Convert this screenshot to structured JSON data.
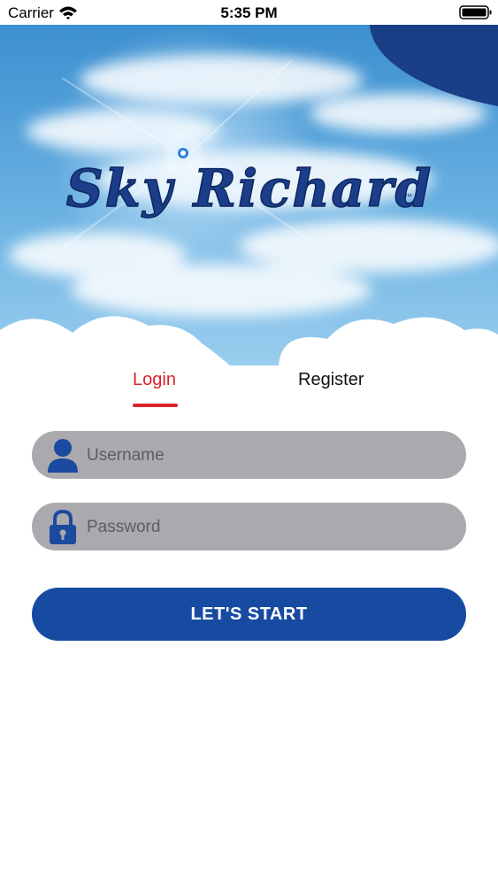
{
  "status_bar": {
    "carrier": "Carrier",
    "time": "5:35 PM",
    "wifi_icon": "wifi-icon",
    "battery_icon": "battery-icon"
  },
  "logo": {
    "text": "Sky Richard",
    "tm": "™"
  },
  "tabs": [
    {
      "label": "Login",
      "active": true
    },
    {
      "label": "Register",
      "active": false
    }
  ],
  "form": {
    "username": {
      "placeholder": "Username",
      "value": "",
      "icon": "user-icon"
    },
    "password": {
      "placeholder": "Password",
      "value": "",
      "icon": "lock-icon"
    }
  },
  "submit_label": "LET'S START",
  "colors": {
    "accent_red": "#d8232a",
    "brand_blue": "#164ba1",
    "field_gray": "#aaa9ae",
    "sky": "#3d95d3"
  }
}
